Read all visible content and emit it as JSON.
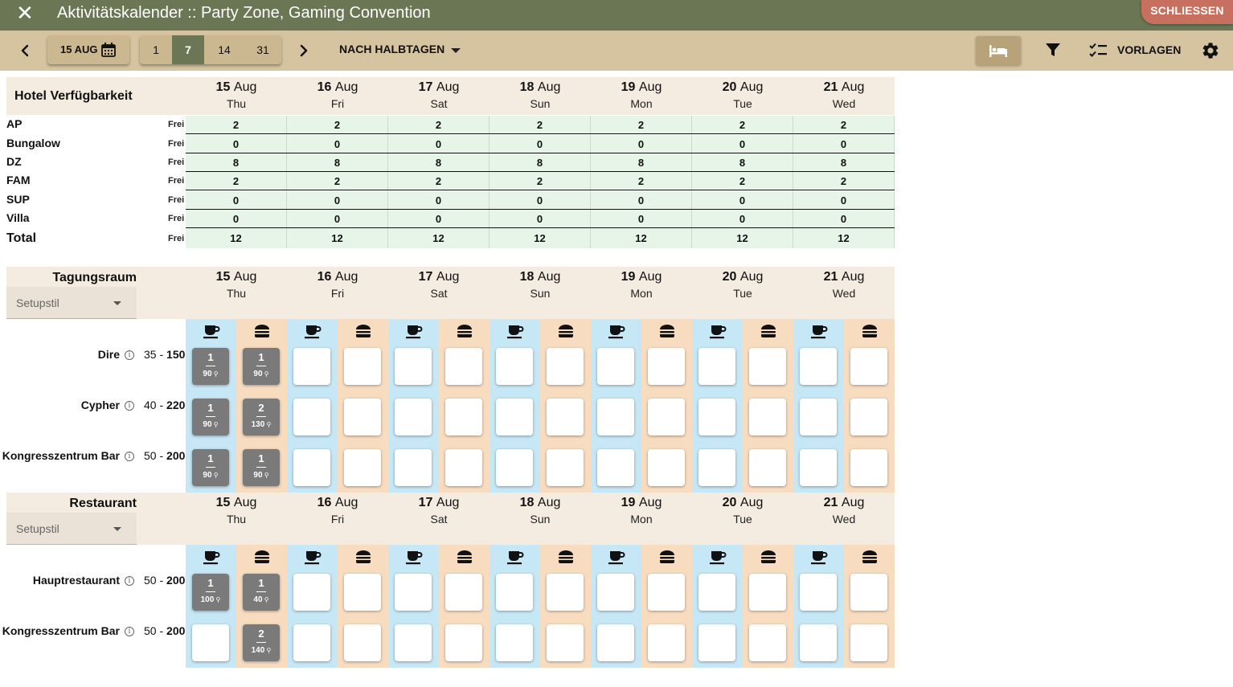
{
  "header": {
    "title": "Aktivitätskalender :: Party Zone, Gaming Convention",
    "close_label": "SCHLIESSEN"
  },
  "toolbar": {
    "date_label": "15 AUG",
    "ranges": [
      "1",
      "7",
      "14",
      "31"
    ],
    "active_range": "7",
    "mode_label": "NACH HALBTAGEN",
    "templates_label": "VORLAGEN"
  },
  "days": [
    {
      "num": "15",
      "mon": "Aug",
      "wd": "Thu"
    },
    {
      "num": "16",
      "mon": "Aug",
      "wd": "Fri"
    },
    {
      "num": "17",
      "mon": "Aug",
      "wd": "Sat"
    },
    {
      "num": "18",
      "mon": "Aug",
      "wd": "Sun"
    },
    {
      "num": "19",
      "mon": "Aug",
      "wd": "Mon"
    },
    {
      "num": "20",
      "mon": "Aug",
      "wd": "Tue"
    },
    {
      "num": "21",
      "mon": "Aug",
      "wd": "Wed"
    }
  ],
  "hotel": {
    "title": "Hotel Verfügbarkeit",
    "free_label": "Frei",
    "rows": [
      {
        "name": "AP",
        "values": [
          "2",
          "2",
          "2",
          "2",
          "2",
          "2",
          "2"
        ]
      },
      {
        "name": "Bungalow",
        "values": [
          "0",
          "0",
          "0",
          "0",
          "0",
          "0",
          "0"
        ]
      },
      {
        "name": "DZ",
        "values": [
          "8",
          "8",
          "8",
          "8",
          "8",
          "8",
          "8"
        ]
      },
      {
        "name": "FAM",
        "values": [
          "2",
          "2",
          "2",
          "2",
          "2",
          "2",
          "2"
        ]
      },
      {
        "name": "SUP",
        "values": [
          "0",
          "0",
          "0",
          "0",
          "0",
          "0",
          "0"
        ]
      },
      {
        "name": "Villa",
        "values": [
          "0",
          "0",
          "0",
          "0",
          "0",
          "0",
          "0"
        ]
      }
    ],
    "total": {
      "name": "Total",
      "values": [
        "12",
        "12",
        "12",
        "12",
        "12",
        "12",
        "12"
      ]
    }
  },
  "sections": [
    {
      "title": "Tagungsraum",
      "setup_label": "Setupstil",
      "rooms": [
        {
          "name": "Dire",
          "cap_min": "35",
          "cap_max": "150",
          "bookings": [
            {
              "slot": 0,
              "count": "1",
              "pax": "90"
            },
            {
              "slot": 1,
              "count": "1",
              "pax": "90"
            }
          ]
        },
        {
          "name": "Cypher",
          "cap_min": "40",
          "cap_max": "220",
          "bookings": [
            {
              "slot": 0,
              "count": "1",
              "pax": "90"
            },
            {
              "slot": 1,
              "count": "2",
              "pax": "130"
            }
          ]
        },
        {
          "name": "Kongresszentrum Bar",
          "cap_min": "50",
          "cap_max": "200",
          "bookings": [
            {
              "slot": 0,
              "count": "1",
              "pax": "90"
            },
            {
              "slot": 1,
              "count": "1",
              "pax": "90"
            }
          ]
        }
      ]
    },
    {
      "title": "Restaurant",
      "setup_label": "Setupstil",
      "rooms": [
        {
          "name": "Hauptrestaurant",
          "cap_min": "50",
          "cap_max": "200",
          "bookings": [
            {
              "slot": 0,
              "count": "1",
              "pax": "100"
            },
            {
              "slot": 1,
              "count": "1",
              "pax": "40"
            }
          ]
        },
        {
          "name": "Kongresszentrum Bar",
          "cap_min": "50",
          "cap_max": "200",
          "bookings": [
            {
              "slot": 1,
              "count": "2",
              "pax": "140"
            }
          ]
        }
      ]
    }
  ],
  "icons": {
    "close": "close-icon",
    "prev": "chevron-left-icon",
    "next": "chevron-right-icon",
    "calendar": "calendar-icon",
    "bed": "bed-icon",
    "filter": "filter-icon",
    "templates": "checklist-icon",
    "settings": "gear-icon",
    "morning": "coffee-cup-icon",
    "afternoon": "burger-icon",
    "info": "info-icon",
    "pax": "person-icon"
  },
  "colors": {
    "titlebar": "#6b7654",
    "toolbar": "#d6c4a0",
    "close_button": "#c7705f",
    "header_bg": "#f4ebe1",
    "hotel_cells": "#e6f5e8",
    "morning_column": "#c6e7f5",
    "afternoon_column": "#f8dcc0",
    "booked_cell": "#7a7a7a"
  }
}
